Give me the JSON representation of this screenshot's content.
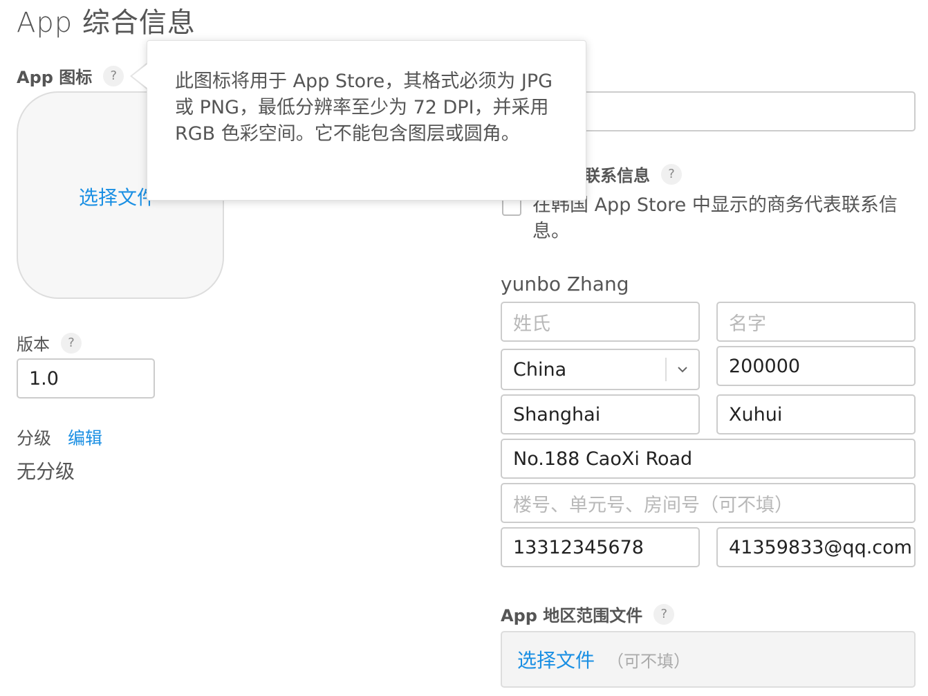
{
  "page_title": "App 综合信息",
  "app_icon": {
    "label": "App 图标",
    "help": "?",
    "choose_file": "选择文件"
  },
  "version": {
    "label": "版本",
    "help": "?",
    "value": "1.0"
  },
  "rating": {
    "label": "分级",
    "edit": "编辑",
    "value": "无分级"
  },
  "contact": {
    "label_visible": "联系信息",
    "help": "?",
    "checkbox_text": "在韩国 App Store 中显示的商务代表联系信息。",
    "full_name": "yunbo Zhang",
    "last_name_placeholder": "姓氏",
    "first_name_placeholder": "名字",
    "country": "China",
    "postal_code": "200000",
    "city": "Shanghai",
    "district": "Xuhui",
    "address": "No.188 CaoXi Road",
    "address2_placeholder": "楼号、单元号、房间号（可不填）",
    "phone": "13312345678",
    "email": "41359833@qq.com"
  },
  "region_file": {
    "label": "App 地区范围文件",
    "help": "?",
    "choose_file": "选择文件",
    "optional": "（可不填）"
  },
  "tooltip": {
    "text": "此图标将用于 App Store，其格式必须为 JPG 或 PNG，最低分辨率至少为 72 DPI，并采用 RGB 色彩空间。它不能包含图层或圆角。"
  }
}
